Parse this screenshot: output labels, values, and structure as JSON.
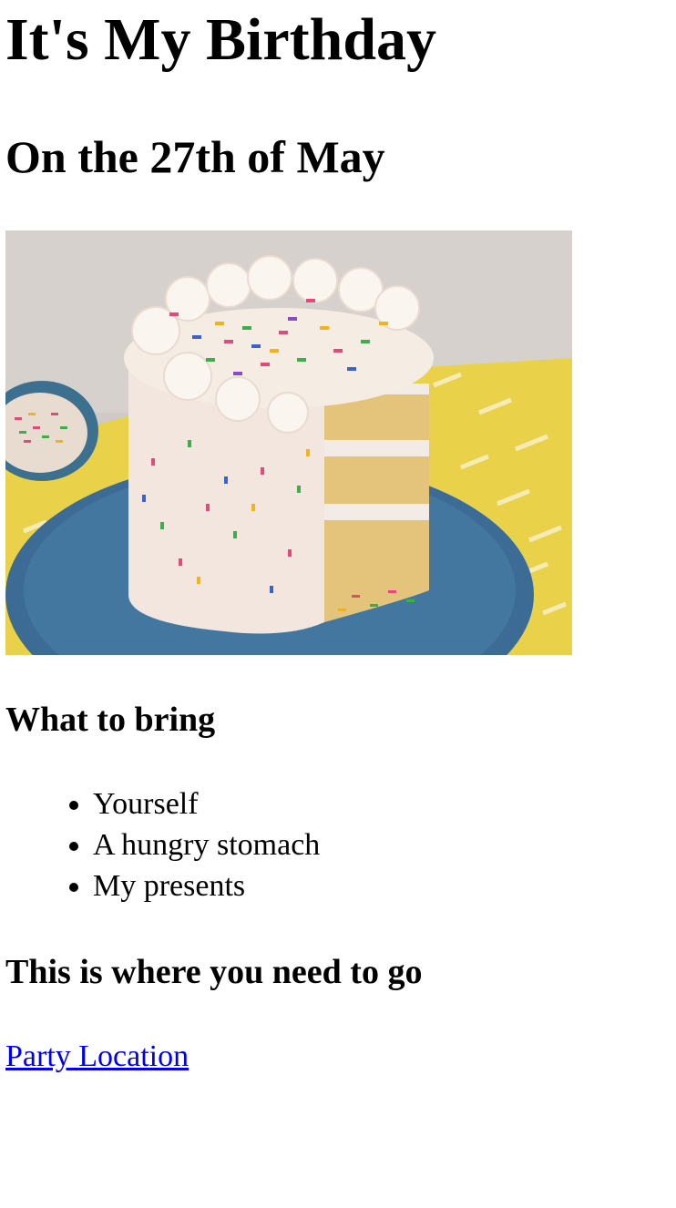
{
  "header": {
    "title": "It's My Birthday",
    "subtitle": "On the 27th of May"
  },
  "image": {
    "icon": "birthday-cake-photo"
  },
  "bring": {
    "heading": "What to bring",
    "items": [
      {
        "label": "Yourself"
      },
      {
        "label": "A hungry stomach"
      },
      {
        "label": "My presents"
      }
    ]
  },
  "location": {
    "heading": "This is where you need to go",
    "link_label": "Party Location",
    "link_color": "#0000ee"
  }
}
